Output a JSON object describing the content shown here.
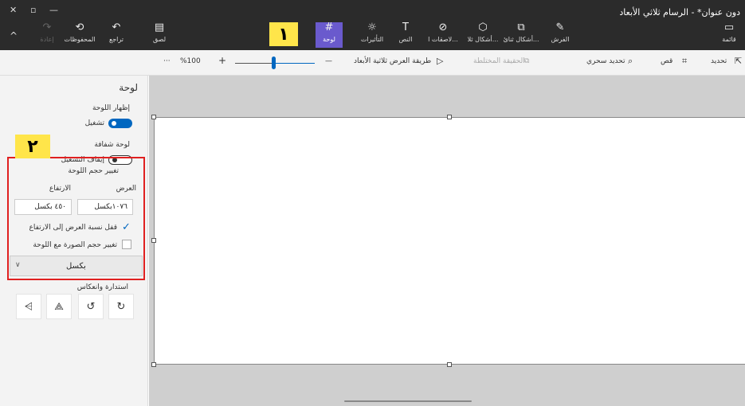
{
  "window": {
    "title": "دون عنوان* - الرسام ثلاثي الأبعاد",
    "close_glyph": "✕",
    "restore_glyph": "▫",
    "minimize_glyph": "—"
  },
  "toolbar": {
    "collapse_glyph": "^",
    "redo": {
      "label": "إعادة",
      "icon": "redo-icon"
    },
    "history": {
      "label": "المحفوظات",
      "icon": "history-icon"
    },
    "undo": {
      "label": "تراجع",
      "icon": "undo-icon"
    },
    "paste": {
      "label": "لصق",
      "icon": "paste-icon"
    },
    "canvas": {
      "label": "لوحة",
      "icon": "canvas-icon"
    },
    "effects": {
      "label": "التأثيرات",
      "icon": "effects-icon"
    },
    "text": {
      "label": "النص",
      "icon": "text-icon"
    },
    "stickers": {
      "label": "لاصقات ا...",
      "icon": "sticker-icon"
    },
    "shapes3d": {
      "label": "أشكال ثلا...",
      "icon": "cube-icon"
    },
    "shapes2d": {
      "label": "أشكال ثنائ...",
      "icon": "shapes-icon"
    },
    "brushes": {
      "label": "الفرش",
      "icon": "brush-icon"
    },
    "menu": {
      "label": "قائمة",
      "icon": "folder-icon"
    }
  },
  "annotations": {
    "badge1": "١",
    "badge2": "٢"
  },
  "toolbar2": {
    "select": "تحديد",
    "crop": "قص",
    "magic_select": "تحديد سحري",
    "mixed_reality": "الحقيقة المختلطة",
    "view_3d": "طريقة العرض ثلاثية الأبعاد",
    "zoom_minus": "—",
    "zoom_plus": "+",
    "zoom": "%100",
    "more": "···"
  },
  "panel": {
    "title": "لوحة",
    "show_canvas": {
      "label": "إظهار اللوحة",
      "state_label": "تشغيل",
      "on": true
    },
    "transparent": {
      "label": "لوحة شفافة",
      "state_label": "إيقاف التشغيل",
      "on": false
    },
    "resize": {
      "title": "تغيير حجم اللوحة",
      "width_label": "العرض",
      "height_label": "الارتفاع",
      "width_value": "١٠٧٦بكسل",
      "height_value": "٤٥٠ بكسل",
      "lock_aspect": {
        "label": "قفل نسبة العرض إلى الارتفاع",
        "checked": true
      },
      "resize_image": {
        "label": "تغيير حجم الصورة مع اللوحة",
        "checked": false
      },
      "unit": "بكسل"
    },
    "rotate_flip": {
      "title": "استدارة وانعكاس"
    }
  }
}
